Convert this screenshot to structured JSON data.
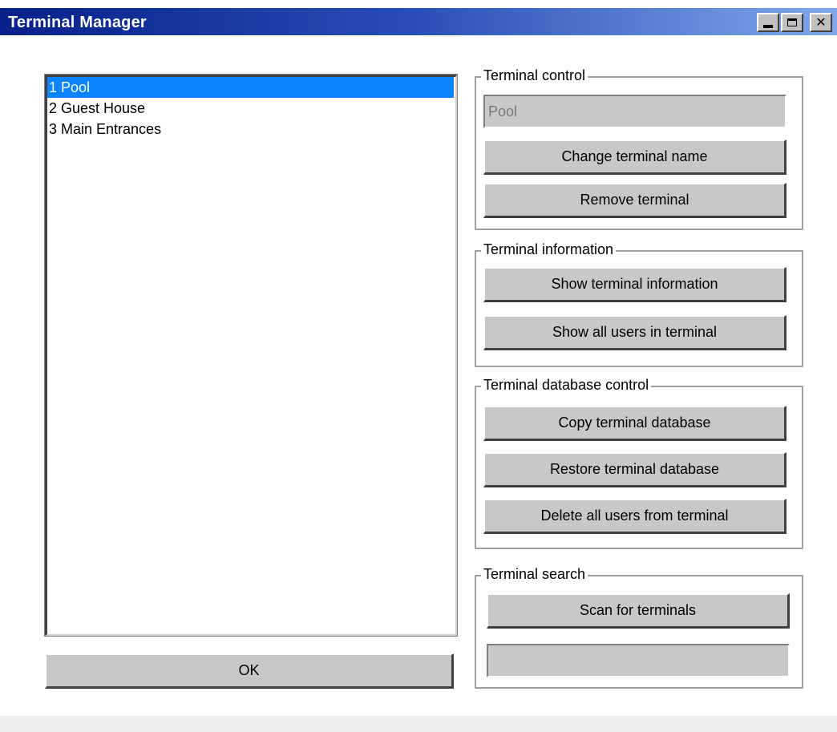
{
  "window": {
    "title": "Terminal Manager"
  },
  "terminal_list": {
    "items": [
      {
        "label": "1 Pool",
        "selected": true
      },
      {
        "label": "2 Guest House",
        "selected": false
      },
      {
        "label": "3 Main Entrances",
        "selected": false
      }
    ]
  },
  "ok_button": {
    "label": "OK"
  },
  "terminal_control": {
    "title": "Terminal control",
    "name_value": "Pool",
    "change_name_label": "Change terminal name",
    "remove_label": "Remove terminal"
  },
  "terminal_information": {
    "title": "Terminal information",
    "show_info_label": "Show terminal information",
    "show_users_label": "Show all users in terminal"
  },
  "terminal_database_control": {
    "title": "Terminal database control",
    "copy_label": "Copy terminal database",
    "restore_label": "Restore terminal database",
    "delete_users_label": "Delete all users from terminal"
  },
  "terminal_search": {
    "title": "Terminal search",
    "scan_label": "Scan for terminals",
    "status_value": ""
  },
  "colors": {
    "titlebar_start": "#06208a",
    "titlebar_end": "#7ea8ea",
    "selection": "#0a84ff",
    "button_face": "#c8c8c8"
  }
}
